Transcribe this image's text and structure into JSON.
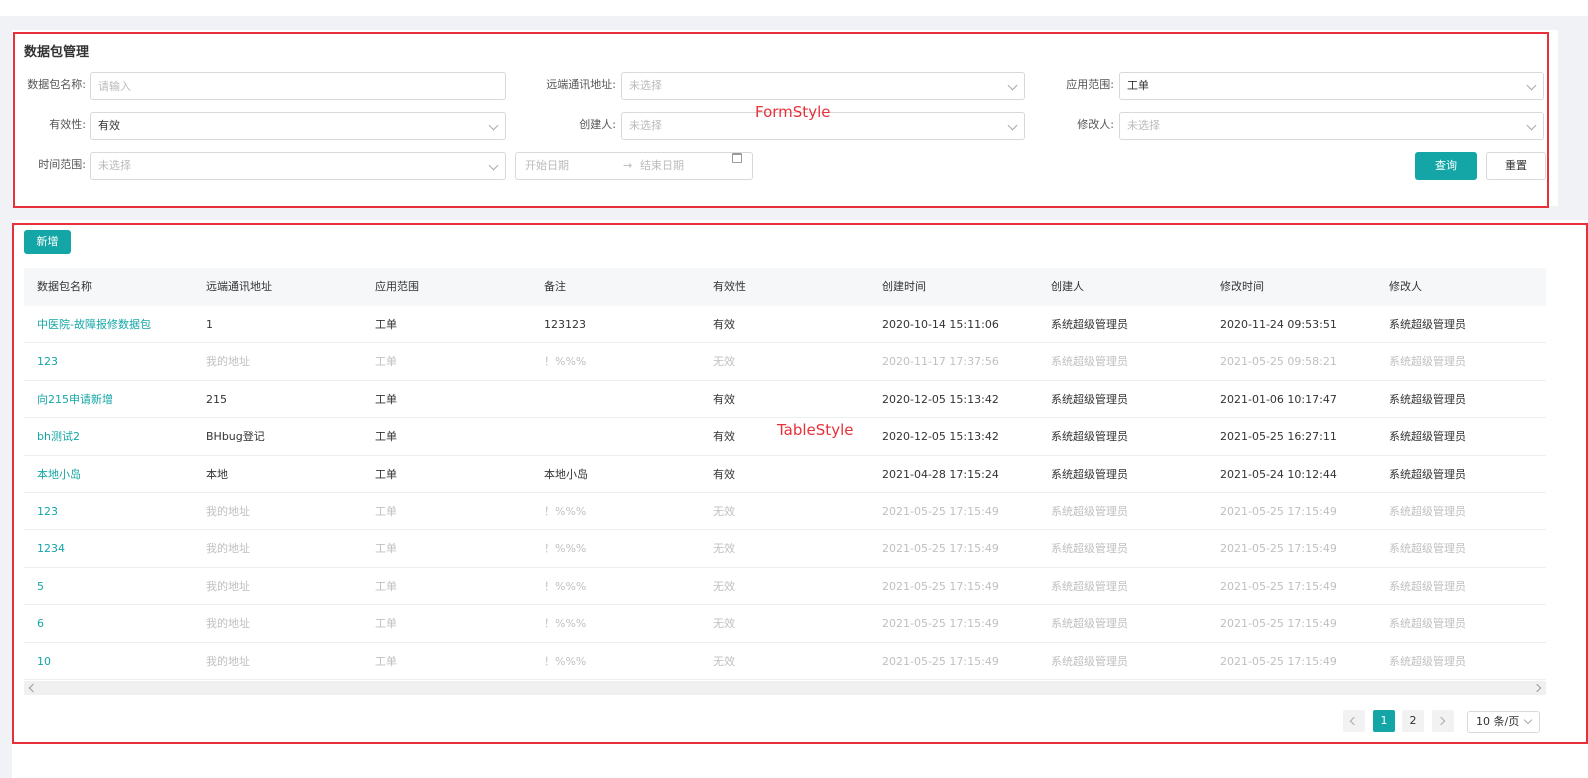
{
  "form": {
    "title": "数据包管理",
    "fields": {
      "name": {
        "label": "数据包名称:",
        "placeholder": "请输入"
      },
      "remote": {
        "label": "远端通讯地址:",
        "value": "未选择"
      },
      "scope": {
        "label": "应用范围:",
        "value": "工单"
      },
      "validity": {
        "label": "有效性:",
        "value": "有效"
      },
      "creator": {
        "label": "创建人:",
        "value": "未选择"
      },
      "modifier": {
        "label": "修改人:",
        "value": "未选择"
      },
      "time": {
        "label": "时间范围:",
        "value": "未选择"
      },
      "date_start": "开始日期",
      "date_arrow": "→",
      "date_end": "结束日期"
    },
    "query_label": "查询",
    "reset_label": "重置",
    "annotation": "FormStyle"
  },
  "table": {
    "add_label": "新增",
    "annotation": "TableStyle",
    "columns": [
      "数据包名称",
      "远端通讯地址",
      "应用范围",
      "备注",
      "有效性",
      "创建时间",
      "创建人",
      "修改时间",
      "修改人"
    ],
    "rows": [
      {
        "invalid": false,
        "cells": [
          "中医院-故障报修数据包",
          "1",
          "工单",
          "123123",
          "有效",
          "2020-10-14 15:11:06",
          "系统超级管理员",
          "2020-11-24 09:53:51",
          "系统超级管理员"
        ]
      },
      {
        "invalid": true,
        "cells": [
          "123",
          "我的地址",
          "工单",
          "！%%%",
          "无效",
          "2020-11-17 17:37:56",
          "系统超级管理员",
          "2021-05-25 09:58:21",
          "系统超级管理员"
        ]
      },
      {
        "invalid": false,
        "cells": [
          "向215申请新增",
          "215",
          "工单",
          "",
          "有效",
          "2020-12-05 15:13:42",
          "系统超级管理员",
          "2021-01-06 10:17:47",
          "系统超级管理员"
        ]
      },
      {
        "invalid": false,
        "cells": [
          "bh测试2",
          "BHbug登记",
          "工单",
          "",
          "有效",
          "2020-12-05 15:13:42",
          "系统超级管理员",
          "2021-05-25 16:27:11",
          "系统超级管理员"
        ]
      },
      {
        "invalid": false,
        "cells": [
          "本地小岛",
          "本地",
          "工单",
          "本地小岛",
          "有效",
          "2021-04-28 17:15:24",
          "系统超级管理员",
          "2021-05-24 10:12:44",
          "系统超级管理员"
        ]
      },
      {
        "invalid": true,
        "cells": [
          "123",
          "我的地址",
          "工单",
          "！%%%",
          "无效",
          "2021-05-25 17:15:49",
          "系统超级管理员",
          "2021-05-25 17:15:49",
          "系统超级管理员"
        ]
      },
      {
        "invalid": true,
        "cells": [
          "1234",
          "我的地址",
          "工单",
          "！%%%",
          "无效",
          "2021-05-25 17:15:49",
          "系统超级管理员",
          "2021-05-25 17:15:49",
          "系统超级管理员"
        ]
      },
      {
        "invalid": true,
        "cells": [
          "5",
          "我的地址",
          "工单",
          "！%%%",
          "无效",
          "2021-05-25 17:15:49",
          "系统超级管理员",
          "2021-05-25 17:15:49",
          "系统超级管理员"
        ]
      },
      {
        "invalid": true,
        "cells": [
          "6",
          "我的地址",
          "工单",
          "！%%%",
          "无效",
          "2021-05-25 17:15:49",
          "系统超级管理员",
          "2021-05-25 17:15:49",
          "系统超级管理员"
        ]
      },
      {
        "invalid": true,
        "cells": [
          "10",
          "我的地址",
          "工单",
          "！%%%",
          "无效",
          "2021-05-25 17:15:49",
          "系统超级管理员",
          "2021-05-25 17:15:49",
          "系统超级管理员"
        ]
      }
    ]
  },
  "pagination": {
    "pages": [
      "1",
      "2"
    ],
    "current": "1",
    "page_size": "10 条/页"
  },
  "colors": {
    "accent": "#14a6a6",
    "annotation": "#e8303a"
  }
}
